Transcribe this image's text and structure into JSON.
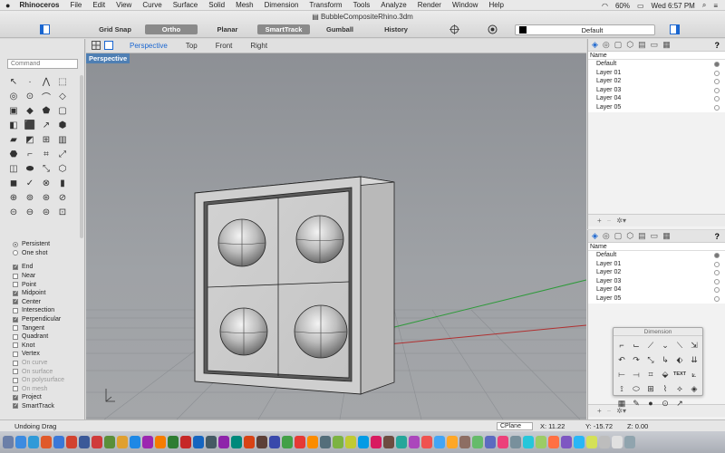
{
  "menubar": {
    "apple": "",
    "app_name": "Rhinoceros",
    "items": [
      "File",
      "Edit",
      "View",
      "Curve",
      "Surface",
      "Solid",
      "Mesh",
      "Dimension",
      "Transform",
      "Tools",
      "Analyze",
      "Render",
      "Window",
      "Help"
    ],
    "battery": "60%",
    "clock": "Wed 6:57 PM"
  },
  "window": {
    "title": "BubbleCompositeRhino.3dm"
  },
  "modes": [
    {
      "label": "Grid Snap",
      "on": false
    },
    {
      "label": "Ortho",
      "on": true
    },
    {
      "label": "Planar",
      "on": false
    },
    {
      "label": "SmartTrack",
      "on": true
    },
    {
      "label": "Gumball",
      "on": false
    },
    {
      "label": "History",
      "on": false
    }
  ],
  "layer_select": {
    "value": "Default"
  },
  "command": {
    "placeholder": "Command"
  },
  "tools": [
    "↖",
    "·",
    "⋀",
    "⬚",
    "◎",
    "⊙",
    "⌒",
    "◇",
    "▣",
    "◆",
    "⬟",
    "▢",
    "◧",
    "⬛",
    "↗",
    "⬢",
    "▰",
    "◩",
    "⊞",
    "▥",
    "⬣",
    "⌐",
    "⌗",
    "⤢",
    "◫",
    "⬬",
    "⤡",
    "⬡",
    "◼",
    "✓",
    "⊗",
    "▮",
    "⊕",
    "⊚",
    "⊛",
    "⊘",
    "⊝",
    "⊖",
    "⊜",
    "⊡"
  ],
  "snap_mode": [
    {
      "label": "Persistent",
      "on": true
    },
    {
      "label": "One shot",
      "on": false
    }
  ],
  "osnaps": [
    {
      "label": "End",
      "checked": true,
      "enabled": true
    },
    {
      "label": "Near",
      "checked": false,
      "enabled": true
    },
    {
      "label": "Point",
      "checked": false,
      "enabled": true
    },
    {
      "label": "Midpoint",
      "checked": true,
      "enabled": true
    },
    {
      "label": "Center",
      "checked": true,
      "enabled": true
    },
    {
      "label": "Intersection",
      "checked": false,
      "enabled": true
    },
    {
      "label": "Perpendicular",
      "checked": true,
      "enabled": true
    },
    {
      "label": "Tangent",
      "checked": false,
      "enabled": true
    },
    {
      "label": "Quadrant",
      "checked": false,
      "enabled": true
    },
    {
      "label": "Knot",
      "checked": false,
      "enabled": true
    },
    {
      "label": "Vertex",
      "checked": false,
      "enabled": true
    },
    {
      "label": "On curve",
      "checked": false,
      "enabled": false
    },
    {
      "label": "On surface",
      "checked": false,
      "enabled": false
    },
    {
      "label": "On polysurface",
      "checked": false,
      "enabled": false
    },
    {
      "label": "On mesh",
      "checked": false,
      "enabled": false
    },
    {
      "label": "Project",
      "checked": true,
      "enabled": true
    },
    {
      "label": "SmartTrack",
      "checked": true,
      "enabled": true
    }
  ],
  "viewport_tabs": [
    {
      "label": "Perspective",
      "active": true
    },
    {
      "label": "Top",
      "active": false
    },
    {
      "label": "Front",
      "active": false
    },
    {
      "label": "Right",
      "active": false
    }
  ],
  "viewport": {
    "label": "Perspective"
  },
  "layers_panel_top": {
    "header": "Name",
    "layers": [
      "Default",
      "Layer 01",
      "Layer 02",
      "Layer 03",
      "Layer 04",
      "Layer 05"
    ],
    "current": "Default"
  },
  "layers_panel_bottom": {
    "header": "Name",
    "layers": [
      "Default",
      "Layer 01",
      "Layer 02",
      "Layer 03",
      "Layer 04",
      "Layer 05"
    ],
    "current": "Default"
  },
  "dimension_palette": {
    "title": "Dimension",
    "tools": [
      "⌐",
      "⌙",
      "⟋",
      "⌄",
      "⟍",
      "⇲",
      "↶",
      "↷",
      "⤡",
      "↳",
      "⬖",
      "⇊",
      "⟝",
      "⟞",
      "⌗",
      "⬙",
      "TEXT",
      "⟀",
      "⟟",
      "⬭",
      "⊞",
      "⌇",
      "⟡",
      "◈",
      "▦",
      "✎",
      "●",
      "⊙",
      "↗",
      ""
    ]
  },
  "status": {
    "message": "Undoing Drag",
    "cplane": "CPlane",
    "x": "X: 11.22",
    "y": "Y: -15.72",
    "z": "Z: 0.00"
  },
  "colors": {
    "accent": "#1a66d0",
    "viewport_bg": "#9ea1a5",
    "axis_red": "#b03030",
    "axis_green": "#2e9a3a"
  }
}
